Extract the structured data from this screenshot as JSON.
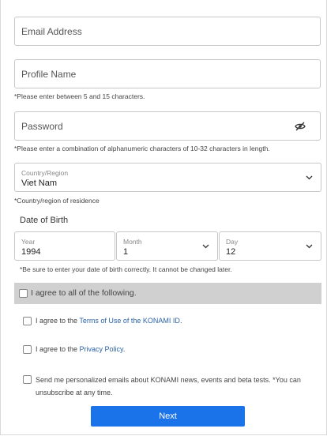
{
  "email": {
    "placeholder": "Email Address"
  },
  "profile": {
    "placeholder": "Profile Name",
    "hint": "*Please enter between 5 and 15 characters."
  },
  "password": {
    "placeholder": "Password",
    "hint": "*Please enter a combination of alphanumeric characters of 10-32 characters in length."
  },
  "country": {
    "label": "Country/Region",
    "value": "Viet Nam",
    "hint": "*Country/region of residence"
  },
  "dob": {
    "title": "Date of Birth",
    "year": {
      "label": "Year",
      "value": "1994"
    },
    "month": {
      "label": "Month",
      "value": "1"
    },
    "day": {
      "label": "Day",
      "value": "12"
    },
    "hint": "*Be sure to enter your date of birth correctly. It cannot be changed later."
  },
  "agree_all": "I agree to all of the following.",
  "terms": {
    "prefix": "I agree to the ",
    "link": "Terms of Use of the KONAMI ID",
    "suffix": "."
  },
  "privacy": {
    "prefix": "I agree to the ",
    "link": "Privacy Policy",
    "suffix": "."
  },
  "emails_line1": "Send me personalized emails about KONAMI news, events and beta tests. *You can",
  "emails_line2": "unsubscribe at any time.",
  "next_label": "Next",
  "colors": {
    "accent": "#1a73e8",
    "link": "#2d63a8",
    "highlight": "#d0d0d0"
  },
  "icons": {
    "password_toggle": "eye-off-icon",
    "dropdown": "chevron-down-icon"
  }
}
